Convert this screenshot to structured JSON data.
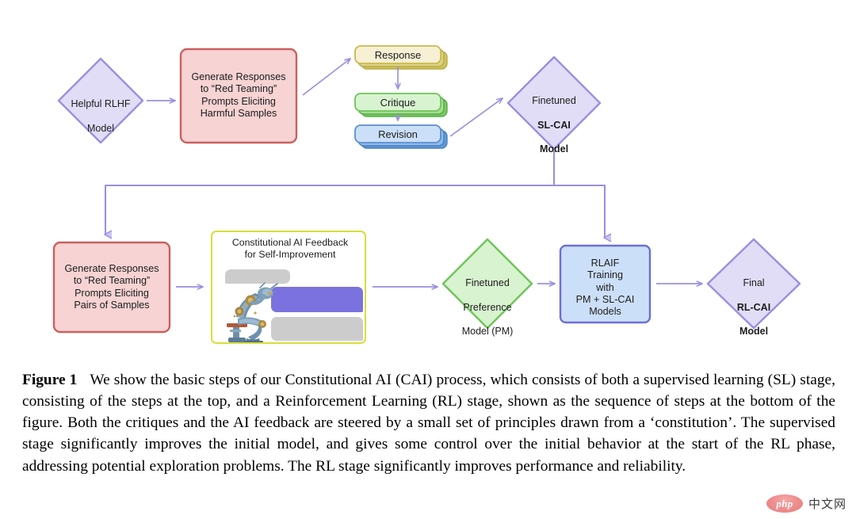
{
  "figure": {
    "nodes": {
      "helpful_rlhf": {
        "line1": "Helpful RLHF",
        "line2": "Model"
      },
      "generate_harmful": {
        "text": "Generate Responses\nto “Red Teaming”\nPrompts Eliciting\nHarmful Samples"
      },
      "response_card": {
        "label": "Response"
      },
      "critique_card": {
        "label": "Critique"
      },
      "revision_card": {
        "label": "Revision"
      },
      "sl_cai": {
        "line1": "Finetuned",
        "line2": "SL-CAI",
        "line3": "Model"
      },
      "generate_pairs": {
        "text": "Generate Responses\nto “Red Teaming”\nPrompts Eliciting\nPairs of Samples"
      },
      "feedback_panel": {
        "title": "Constitutional AI Feedback\nfor Self-Improvement"
      },
      "preference_model": {
        "line1": "Finetuned",
        "line2": "Preference",
        "line3": "Model (PM)"
      },
      "rlaif_training": {
        "text": "RLAIF\nTraining\nwith\nPM + SL-CAI\nModels"
      },
      "rl_cai": {
        "line1": "Final",
        "line2": "RL-CAI",
        "line3": "Model"
      }
    },
    "colors": {
      "purple_fill": "#e2ddf7",
      "purple_stroke": "#9b8fe0",
      "red_fill": "#f7d3d3",
      "red_stroke": "#c9615f",
      "yellow_fill": "#f7f0d5",
      "yellow_stroke": "#c9bc4a",
      "green_fill": "#d8f3d0",
      "green_stroke": "#6fc45a",
      "blue_fill": "#ccdff8",
      "blue_stroke": "#5b8fd4",
      "panel_stroke": "#d8de3a",
      "arrow": "#9b8fe0",
      "bubble_gray": "#cccccc",
      "bubble_purple": "#7b72e0"
    }
  },
  "caption": {
    "label": "Figure 1",
    "body": "We show the basic steps of our Constitutional AI (CAI) process, which consists of both a supervised learning (SL) stage, consisting of the steps at the top, and a Reinforcement Learning (RL) stage, shown as the sequence of steps at the bottom of the figure. Both the critiques and the AI feedback are steered by a small set of principles drawn from a ‘constitution’. The supervised stage significantly improves the initial model, and gives some control over the initial behavior at the start of the RL phase, addressing potential exploration problems. The RL stage significantly improves performance and reliability."
  },
  "watermark": {
    "logo_text": "php",
    "site_text": "中文网"
  }
}
